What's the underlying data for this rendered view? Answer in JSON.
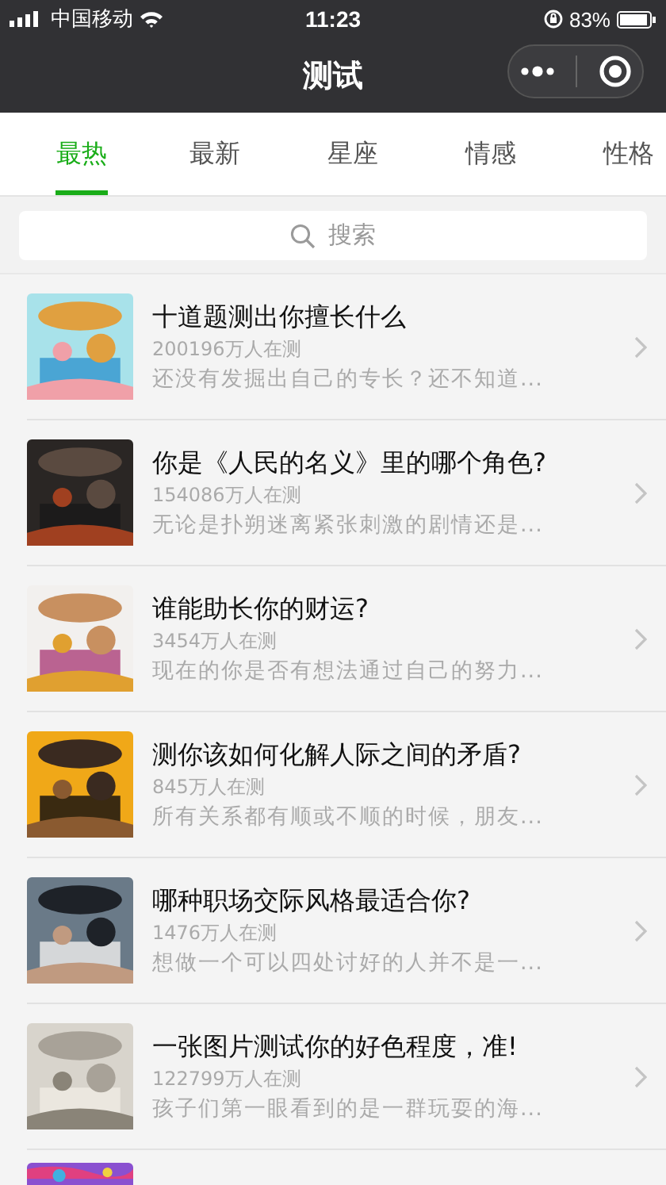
{
  "status_bar": {
    "carrier": "中国移动",
    "time": "11:23",
    "battery": "83%"
  },
  "nav_bar": {
    "title": "测试"
  },
  "tabs": [
    {
      "label": "最热",
      "selected": true
    },
    {
      "label": "最新",
      "selected": false
    },
    {
      "label": "星座",
      "selected": false
    },
    {
      "label": "情感",
      "selected": false
    },
    {
      "label": "性格",
      "selected": false
    }
  ],
  "search": {
    "placeholder": "搜索"
  },
  "quizzes": [
    {
      "title": "十道题测出你擅长什么",
      "count": "200196万人在测",
      "description": "还没有发掘出自己的专长？还不知道..."
    },
    {
      "title": "你是《人民的名义》里的哪个角色?",
      "count": "154086万人在测",
      "description": "无论是扑朔迷离紧张刺激的剧情还是..."
    },
    {
      "title": "谁能助长你的财运?",
      "count": "3454万人在测",
      "description": "现在的你是否有想法通过自己的努力..."
    },
    {
      "title": "测你该如何化解人际之间的矛盾?",
      "count": "845万人在测",
      "description": "所有关系都有顺或不顺的时候，朋友..."
    },
    {
      "title": "哪种职场交际风格最适合你?",
      "count": "1476万人在测",
      "description": "想做一个可以四处讨好的人并不是一..."
    },
    {
      "title": "一张图片测试你的好色程度，准!",
      "count": "122799万人在测",
      "description": "孩子们第一眼看到的是一群玩耍的海..."
    }
  ]
}
